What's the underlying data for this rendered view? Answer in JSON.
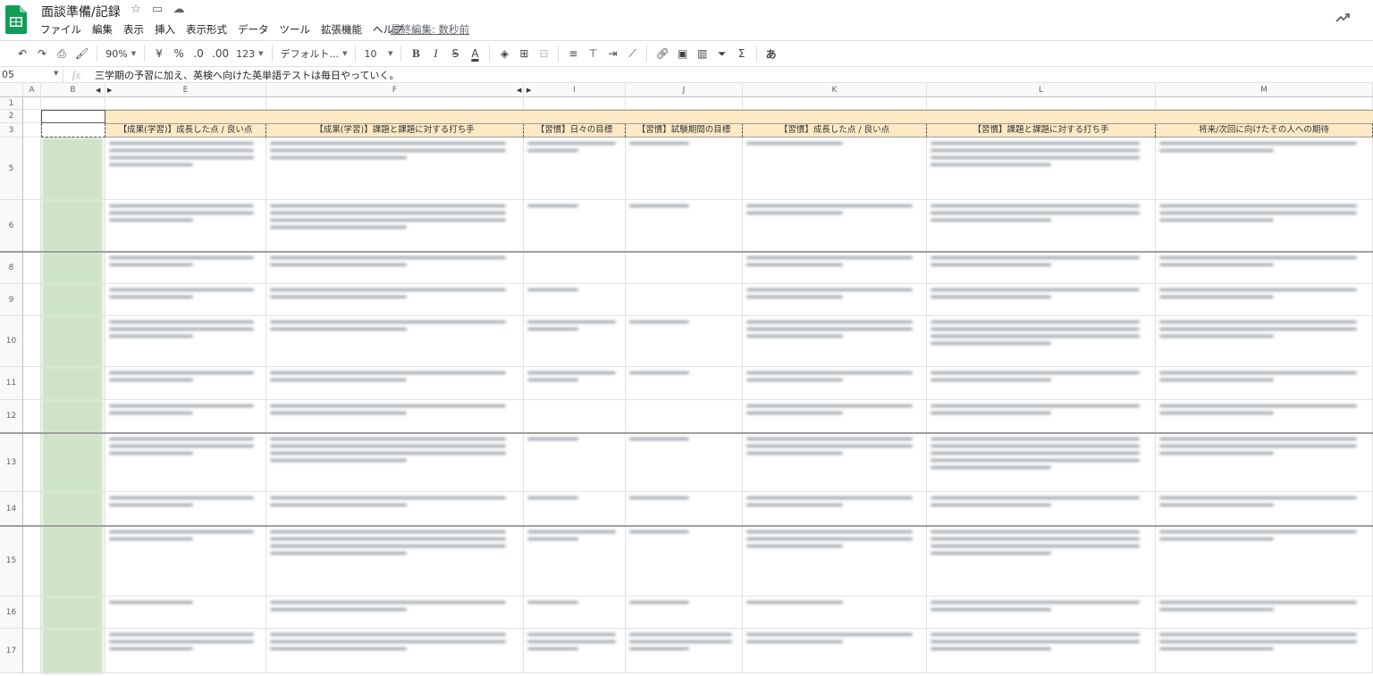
{
  "app": {
    "title": "面談準備/記録",
    "last_edit": "最終編集: 数秒前"
  },
  "title_icons": [
    "star-icon",
    "folder-move-icon",
    "cloud-status-icon"
  ],
  "menu": [
    "ファイル",
    "編集",
    "表示",
    "挿入",
    "表示形式",
    "データ",
    "ツール",
    "拡張機能",
    "ヘルプ"
  ],
  "toolbar": {
    "zoom": "90%",
    "currency": "¥",
    "percent": "%",
    "dec_decrease": ".0",
    "dec_increase": ".00",
    "format_more": "123",
    "font": "デフォルト...",
    "font_size": "10",
    "bold": "B",
    "italic": "I",
    "strike": "S",
    "font_color": "A",
    "input_tools": "あ"
  },
  "formula_bar": {
    "cell_ref": "05",
    "fx": "fx",
    "content": "三学期の予習に加え、英検へ向けた英単語テストは毎日やっていく。"
  },
  "columns": [
    {
      "id": "A",
      "label": "A"
    },
    {
      "id": "B",
      "label": "B"
    },
    {
      "id": "E",
      "label": "E"
    },
    {
      "id": "F",
      "label": "F"
    },
    {
      "id": "I",
      "label": "I"
    },
    {
      "id": "J",
      "label": "J"
    },
    {
      "id": "K",
      "label": "K"
    },
    {
      "id": "L",
      "label": "L"
    },
    {
      "id": "M",
      "label": "M"
    }
  ],
  "rows": [
    "1",
    "2",
    "3",
    "5",
    "6",
    "8",
    "9",
    "10",
    "11",
    "12",
    "13",
    "14",
    "15",
    "16",
    "17"
  ],
  "headers": {
    "E": "【成果(学習)】成長した点 / 良い点",
    "F": "【成果(学習)】課題と課題に対する打ち手",
    "I": "【習慣】日々の目標",
    "J": "【習慣】試験期間の目標",
    "K": "【習慣】成長した点 / 良い点",
    "L": "【習慣】課題と課題に対する打ち手",
    "M": "将来/次回に向けたその人への期待"
  },
  "colors": {
    "header_fill": "#fde9c4",
    "name_fill": "#cfe3c8",
    "sheets_green": "#0f9d58"
  }
}
